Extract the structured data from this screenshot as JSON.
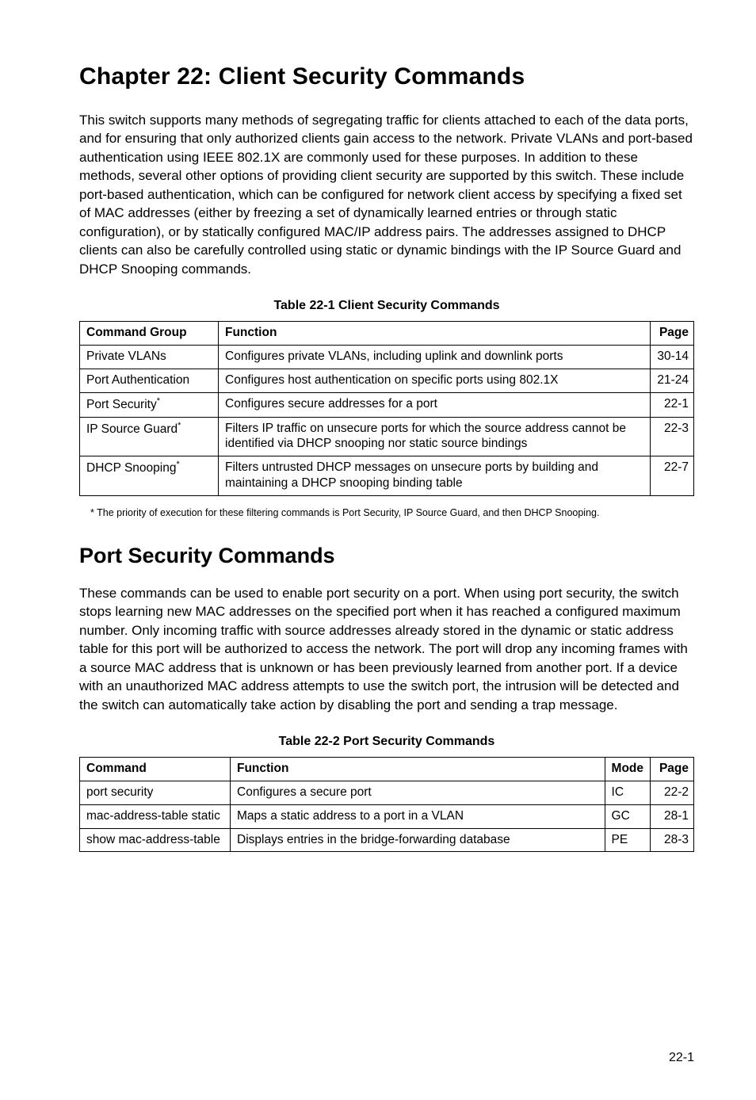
{
  "chapter": {
    "title": "Chapter 22: Client Security Commands",
    "intro": "This switch supports many methods of segregating traffic for clients attached to each of the data ports, and for ensuring that only authorized clients gain access to the network. Private VLANs and port-based authentication using IEEE 802.1X are commonly used for these purposes. In addition to these methods, several other options of providing client security are supported by this switch. These include port-based authentication, which can be configured for network client access by specifying a fixed set of MAC addresses (either by freezing a set of dynamically learned entries or through static configuration), or by statically configured MAC/IP address pairs. The addresses assigned to DHCP clients can also be carefully controlled using static or dynamic bindings with the IP Source Guard and DHCP Snooping commands."
  },
  "table1": {
    "caption": "Table 22-1   Client Security Commands",
    "headers": {
      "c1": "Command Group",
      "c2": "Function",
      "c3": "Page"
    },
    "rows": [
      {
        "group": "Private VLANs",
        "asterisk": false,
        "function": "Configures private VLANs, including uplink and downlink ports",
        "page": "30-14"
      },
      {
        "group": "Port Authentication",
        "asterisk": false,
        "function": "Configures host authentication on specific ports using 802.1X",
        "page": "21-24"
      },
      {
        "group": "Port Security",
        "asterisk": true,
        "function": "Configures secure addresses for a port",
        "page": "22-1"
      },
      {
        "group": "IP Source Guard",
        "asterisk": true,
        "function": "Filters IP traffic on unsecure ports for which the source address cannot be identified via DHCP snooping nor static source bindings",
        "page": "22-3"
      },
      {
        "group": "DHCP Snooping",
        "asterisk": true,
        "function": "Filters untrusted DHCP messages on unsecure ports by building and maintaining a DHCP snooping binding table",
        "page": "22-7"
      }
    ],
    "footnote": "*  The priority of execution for these filtering commands is Port Security, IP Source Guard, and then DHCP Snooping."
  },
  "section": {
    "title": "Port Security Commands",
    "body": "These commands can be used to enable port security on a port. When using port security, the switch stops learning new MAC addresses on the specified port when it has reached a configured maximum number. Only incoming traffic with source addresses already stored in the dynamic or static address table for this port will be authorized to access the network. The port will drop any incoming frames with a source MAC address that is unknown or has been previously learned from another port. If a device with an unauthorized MAC address attempts to use the switch port, the intrusion will be detected and the switch can automatically take action by disabling the port and sending a trap message."
  },
  "table2": {
    "caption": "Table 22-2   Port Security Commands",
    "headers": {
      "c1": "Command",
      "c2": "Function",
      "c3": "Mode",
      "c4": "Page"
    },
    "rows": [
      {
        "cmd": "port security",
        "function": "Configures a secure port",
        "mode": "IC",
        "page": "22-2"
      },
      {
        "cmd": "mac-address-table static",
        "function": "Maps a static address to a port in a VLAN",
        "mode": "GC",
        "page": "28-1"
      },
      {
        "cmd": "show mac-address-table",
        "function": "Displays entries in the bridge-forwarding database",
        "mode": "PE",
        "page": "28-3"
      }
    ]
  },
  "pageNumber": "22-1"
}
